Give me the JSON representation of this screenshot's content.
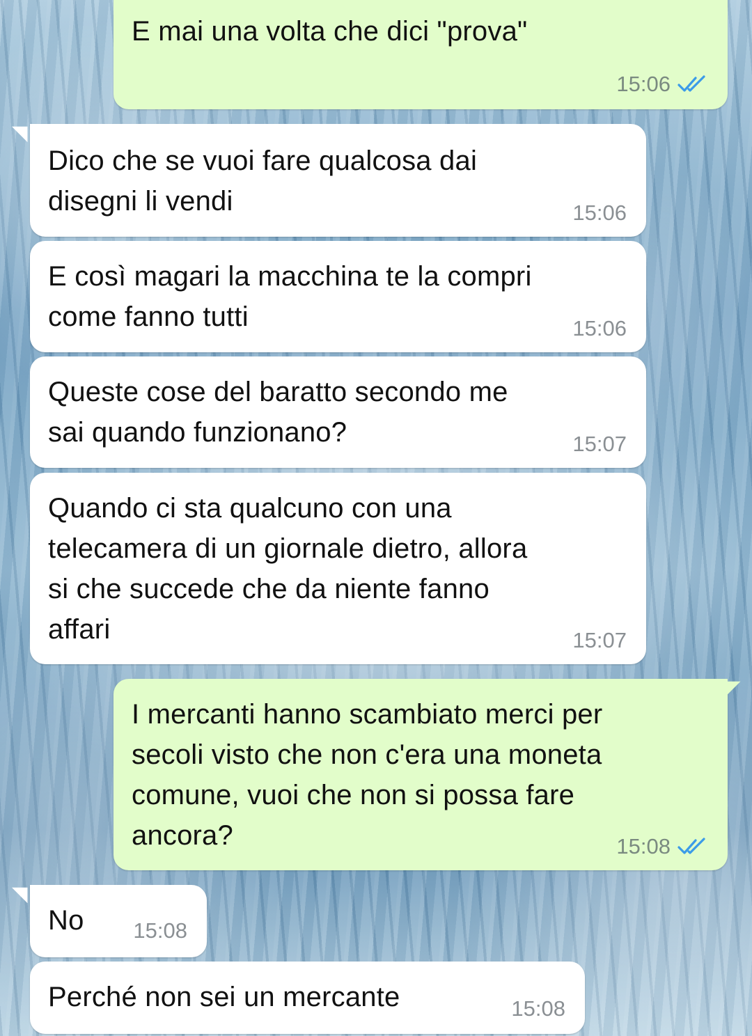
{
  "colors": {
    "incoming_bubble": "#ffffff",
    "outgoing_bubble": "#e2fdca",
    "read_ticks": "#3b9be8",
    "time_text": "#8a8f93"
  },
  "messages": [
    {
      "direction": "out",
      "text": "E mai una volta che dici \"prova\"",
      "time": "15:06",
      "status_icon": "double-check-read-icon"
    },
    {
      "direction": "in",
      "text": "Dico che se vuoi fare qualcosa dai\ndisegni li vendi",
      "time": "15:06"
    },
    {
      "direction": "in",
      "text": "E così magari la macchina te la compri\ncome fanno tutti",
      "time": "15:06"
    },
    {
      "direction": "in",
      "text": "Queste cose del baratto secondo me\nsai quando funzionano?",
      "time": "15:07"
    },
    {
      "direction": "in",
      "text": "Quando ci sta qualcuno con una\ntelecamera di un giornale dietro, allora\nsi che succede che da niente fanno\naffari",
      "time": "15:07"
    },
    {
      "direction": "out",
      "text": "I mercanti hanno scambiato merci per\nsecoli visto che non c'era una moneta\ncomune, vuoi che non si possa fare\nancora?",
      "time": "15:08",
      "status_icon": "double-check-read-icon"
    },
    {
      "direction": "in",
      "text": "No",
      "time": "15:08"
    },
    {
      "direction": "in",
      "text": "Perché non sei un mercante",
      "time": "15:08"
    }
  ]
}
